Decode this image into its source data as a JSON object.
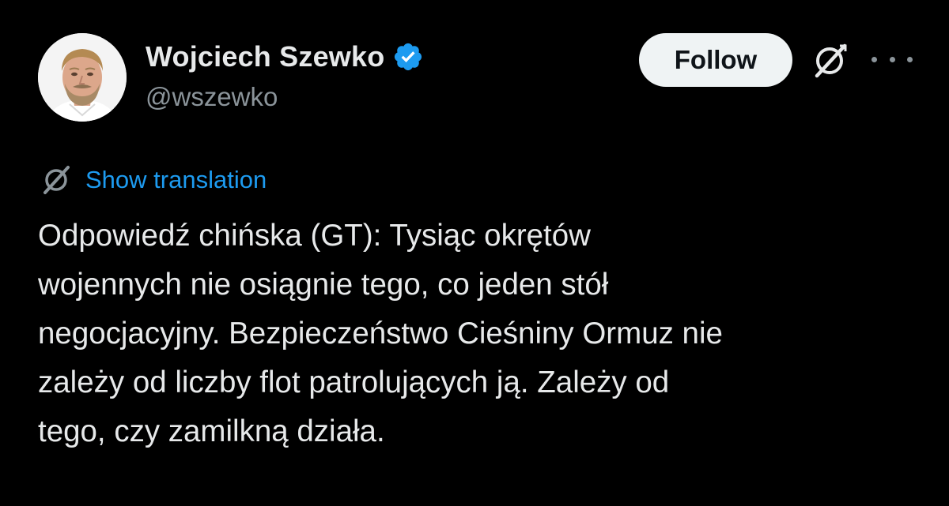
{
  "author": {
    "display_name": "Wojciech Szewko",
    "handle": "@wszewko",
    "verified": true,
    "avatar": "profile-photo"
  },
  "actions": {
    "follow_label": "Follow",
    "grok_icon": "grok-icon",
    "more_icon": "more-horizontal-icon"
  },
  "translation": {
    "icon": "grok-translate-icon",
    "link_label": "Show translation"
  },
  "tweet": {
    "text": "Odpowiedź chińska (GT):  Tysiąc okrętów\nwojennych nie osiągnie tego, co jeden stół\nnegocjacyjny. Bezpieczeństwo Cieśniny Ormuz nie\nzależy od liczby flot patrolujących ją. Zależy od\ntego, czy zamilkną działa."
  },
  "colors": {
    "background": "#000000",
    "primary_text": "#e7e9ea",
    "secondary_text": "#8b949a",
    "link": "#1d9bf0",
    "verified_badge": "#1d9bf0",
    "follow_button_bg": "#eff3f4"
  }
}
